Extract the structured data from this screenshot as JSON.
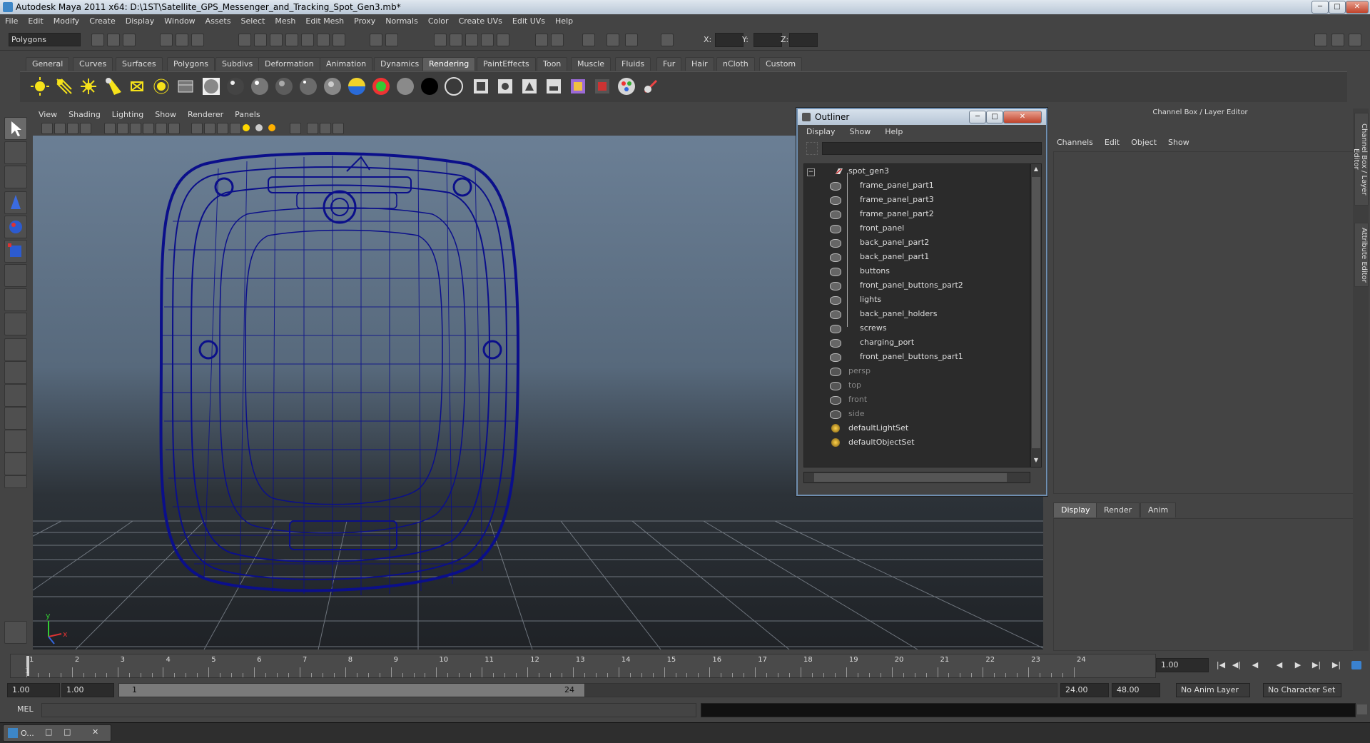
{
  "window": {
    "title": "Autodesk Maya 2011 x64: D:\\1ST\\Satellite_GPS_Messenger_and_Tracking_Spot_Gen3.mb*",
    "min": "─",
    "max": "□",
    "close": "✕"
  },
  "menubar": [
    "File",
    "Edit",
    "Modify",
    "Create",
    "Display",
    "Window",
    "Assets",
    "Select",
    "Mesh",
    "Edit Mesh",
    "Proxy",
    "Normals",
    "Color",
    "Create UVs",
    "Edit UVs",
    "Help"
  ],
  "statusline": {
    "mode": "Polygons",
    "x_label": "X:",
    "y_label": "Y:",
    "z_label": "Z:"
  },
  "shelf_tabs": [
    "General",
    "Curves",
    "Surfaces",
    "Polygons",
    "Subdivs",
    "Deformation",
    "Animation",
    "Dynamics",
    "Rendering",
    "PaintEffects",
    "Toon",
    "Muscle",
    "Fluids",
    "Fur",
    "Hair",
    "nCloth",
    "Custom"
  ],
  "shelf_active": "Rendering",
  "viewport_menu": [
    "View",
    "Shading",
    "Lighting",
    "Show",
    "Renderer",
    "Panels"
  ],
  "axis": {
    "y": "y",
    "x": "x"
  },
  "outliner": {
    "title": "Outliner",
    "menu": [
      "Display",
      "Show",
      "Help"
    ],
    "root": "spot_gen3",
    "children": [
      "frame_panel_part1",
      "frame_panel_part3",
      "frame_panel_part2",
      "front_panel",
      "back_panel_part2",
      "back_panel_part1",
      "buttons",
      "front_panel_buttons_part2",
      "lights",
      "back_panel_holders",
      "screws",
      "charging_port",
      "front_panel_buttons_part1"
    ],
    "cameras": [
      "persp",
      "top",
      "front",
      "side"
    ],
    "sets": [
      "defaultLightSet",
      "defaultObjectSet"
    ]
  },
  "channel_box": {
    "title": "Channel Box / Layer Editor",
    "menu": [
      "Channels",
      "Edit",
      "Object",
      "Show"
    ],
    "layer_tabs": [
      "Display",
      "Render",
      "Anim"
    ],
    "side_tabs": [
      "Channel Box / Layer Editor",
      "Attribute Editor"
    ]
  },
  "timeslider": {
    "labels": [
      "1",
      "2",
      "3",
      "4",
      "5",
      "6",
      "7",
      "8",
      "9",
      "10",
      "11",
      "12",
      "13",
      "14",
      "15",
      "16",
      "17",
      "18",
      "19",
      "20",
      "21",
      "22",
      "23",
      "24"
    ],
    "current_label": "1",
    "current_frame": "1.00"
  },
  "range": {
    "start": "1.00",
    "inner_start": "1.00",
    "range_start_label": "1",
    "range_end_label": "24",
    "end": "24.00",
    "total_end": "48.00",
    "anim_layer": "No Anim Layer",
    "char_set": "No Character Set"
  },
  "mel": {
    "label": "MEL"
  },
  "taskbar": {
    "item": "O..."
  },
  "colors": {
    "wireframe": "#0b0f8a",
    "grid": "#8e96a0",
    "outliner_border": "#6f8fb1"
  }
}
